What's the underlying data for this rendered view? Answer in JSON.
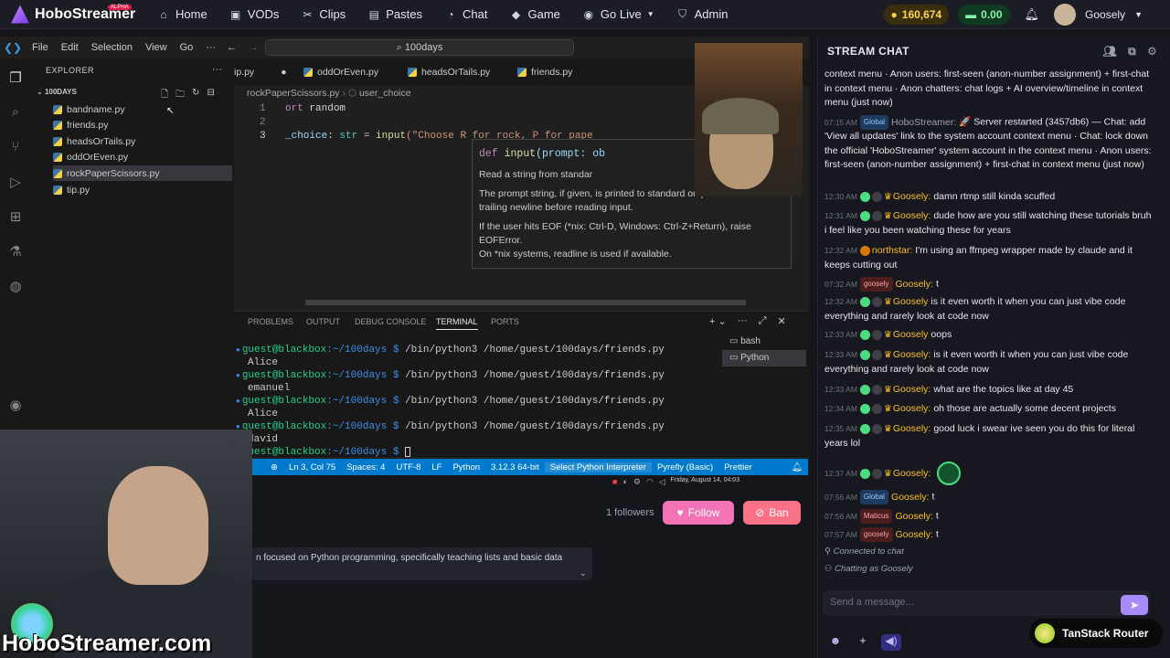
{
  "nav": {
    "brand": "HoboStreamer",
    "brand_badge": "ALPHA",
    "items": [
      {
        "label": "Home",
        "icon": "home-icon",
        "glyph": "⌂"
      },
      {
        "label": "VODs",
        "icon": "video-icon",
        "glyph": "▣"
      },
      {
        "label": "Clips",
        "icon": "scissors-icon",
        "glyph": "✂"
      },
      {
        "label": "Pastes",
        "icon": "clipboard-icon",
        "glyph": "▤"
      },
      {
        "label": "Chat",
        "icon": "chat-icon",
        "glyph": "◔"
      },
      {
        "label": "Game",
        "icon": "gamepad-icon",
        "glyph": "◆"
      },
      {
        "label": "Go Live",
        "icon": "broadcast-icon",
        "glyph": "◉"
      },
      {
        "label": "Admin",
        "icon": "shield-icon",
        "glyph": "⛉"
      }
    ],
    "coins": "160,674",
    "cash": "0.00",
    "username": "Goosely"
  },
  "vscode": {
    "menu": [
      "File",
      "Edit",
      "Selection",
      "View",
      "Go",
      "···"
    ],
    "search": "100days",
    "explorer_title": "EXPLORER",
    "folder": "100DAYS",
    "files": [
      "bandname.py",
      "friends.py",
      "headsOrTails.py",
      "oddOrEven.py",
      "rockPaperScissors.py",
      "tip.py"
    ],
    "tabs": [
      "ip.py",
      "oddOrEven.py",
      "headsOrTails.py",
      "friends.py"
    ],
    "breadcrumb_file": "rockPaperScissors.py",
    "breadcrumb_symbol": "user_choice",
    "code_lines": [
      "1",
      "2",
      "3"
    ],
    "code": {
      "l1_kw": "ort",
      "l1_rest": " random",
      "l3_var": "_choice",
      "l3_mid": ": ",
      "l3_type": "str",
      "l3_eq": " = ",
      "l3_fn": "input",
      "l3_str": "(\"Choose R for rock, P for pape"
    },
    "hover": {
      "sig_def": "def ",
      "sig_fn": "input",
      "sig_rest": "(prompt: ob",
      "p1": "Read a string from standar",
      "p2": "The prompt string, if given, is printed to standard output without a trailing newline before reading input.",
      "p3": "If the user hits EOF (*nix: Ctrl-D, Windows: Ctrl-Z+Return), raise EOFError.",
      "p4": "On *nix systems, readline is used if available."
    },
    "panel_tabs": [
      "PROBLEMS",
      "OUTPUT",
      "DEBUG CONSOLE",
      "TERMINAL",
      "PORTS"
    ],
    "terminal": [
      {
        "prompt": "guest@blackbox",
        "path": ":~/100days $ ",
        "cmd": "/bin/python3 /home/guest/100days/friends.py"
      },
      {
        "out": "Alice"
      },
      {
        "prompt": "guest@blackbox",
        "path": ":~/100days $ ",
        "cmd": "/bin/python3 /home/guest/100days/friends.py"
      },
      {
        "out": "emanuel"
      },
      {
        "prompt": "guest@blackbox",
        "path": ":~/100days $ ",
        "cmd": "/bin/python3 /home/guest/100days/friends.py"
      },
      {
        "out": "Alice"
      },
      {
        "prompt": "guest@blackbox",
        "path": ":~/100days $ ",
        "cmd": "/bin/python3 /home/guest/100days/friends.py"
      },
      {
        "out": "david"
      },
      {
        "prompt": "guest@blackbox",
        "path": ":~/100days $ ",
        "cmd": ""
      }
    ],
    "sessions": [
      "bash",
      "Python"
    ],
    "status": [
      "Ln 3, Col 75",
      "Spaces: 4",
      "UTF-8",
      "LF",
      "Python",
      "3.12.3 64-bit",
      "Select Python Interpreter",
      "Pyrefly (Basic)",
      "Prettier"
    ],
    "clock": "Friday, August 14, 04:03"
  },
  "stream": {
    "followers": "1 followers",
    "follow_label": "Follow",
    "ban_label": "Ban",
    "description": "n focused on Python programming, specifically teaching lists and basic data",
    "watermark": "HoboStreamer.com"
  },
  "chat": {
    "title": "STREAM CHAT",
    "messages": [
      {
        "text": "context menu · Anon users: first-seen (anon-number assignment) + first-chat in context menu · Anon chatters: chat logs + AI overview/timeline in context menu (just now)"
      },
      {
        "ts": "07:15 AM",
        "tag": "Global",
        "user": "HoboStreamer:",
        "text": "🚀 Server restarted (3457db6) — Chat: add 'View all updates' link to the system account context menu · Chat: lock down the official 'HoboStreamer' system account in the context menu · Anon users: first-seen (anon-number assignment) + first-chat in context menu (just now)"
      },
      {
        "ts": "12:30 AM",
        "user": "Goosely:",
        "text": "damn rtmp still kinda scuffed"
      },
      {
        "ts": "12:31 AM",
        "user": "Goosely:",
        "text": "dude how are you still watching these tutorials bruh i feel like you been watching these for years"
      },
      {
        "ts": "12:32 AM",
        "user": "northstar:",
        "text": "I'm using an ffmpeg wrapper made by claude and it keeps cutting out"
      },
      {
        "ts": "07:32 AM",
        "tag": "goosely",
        "user": "Goosely:",
        "text": "t"
      },
      {
        "ts": "12:32 AM",
        "user": "Goosely",
        "text": "is it even worth it when you can just vibe code everything and rarely look at code now"
      },
      {
        "ts": "12:33 AM",
        "user": "Goosely",
        "text": "oops"
      },
      {
        "ts": "12:33 AM",
        "user": "Goosely:",
        "text": "is it even worth it when you can just vibe code everything and rarely look at code now"
      },
      {
        "ts": "12:33 AM",
        "user": "Goosely:",
        "text": "what are the topics like at day 45"
      },
      {
        "ts": "12:34 AM",
        "user": "Goosely:",
        "text": "oh those are actually some decent projects"
      },
      {
        "ts": "12:35 AM",
        "user": "Goosely:",
        "text": "good luck i swear ive seen you do this for literal years lol"
      },
      {
        "ts": "12:37 AM",
        "user": "Goosely:",
        "text": ""
      },
      {
        "ts": "07:56 AM",
        "tag": "Global",
        "user": "Goosely:",
        "text": "t"
      },
      {
        "ts": "07:56 AM",
        "tag": "Maticus",
        "user": "Goosely:",
        "text": "t"
      },
      {
        "ts": "07:57 AM",
        "tag": "goosely",
        "user": "Goosely:",
        "text": "t"
      }
    ],
    "connected": "Connected to chat",
    "chatting_as": "Chatting as Goosely",
    "input_placeholder": "Send a message...",
    "tanstack": "TanStack Router"
  },
  "colors": {
    "accent": "#a78bfa",
    "status_bar": "#007acc",
    "follow": "#f472b6",
    "ban": "#fb7185",
    "gold": "#fbbf24"
  }
}
